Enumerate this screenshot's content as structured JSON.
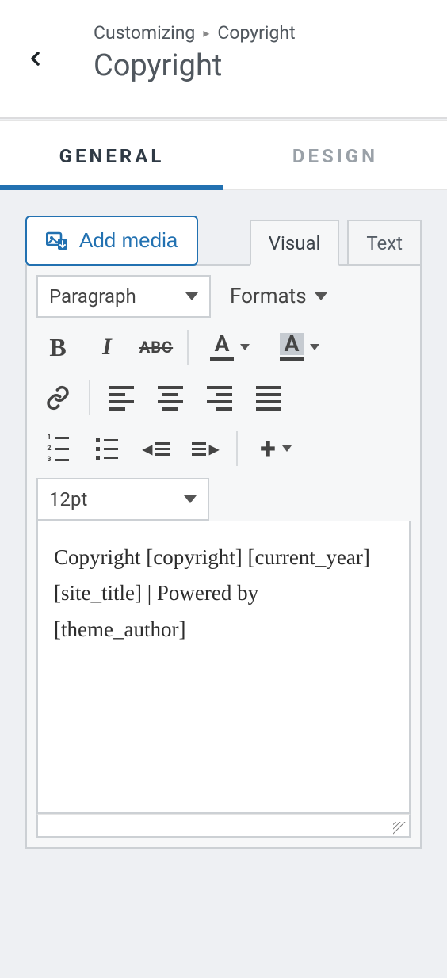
{
  "header": {
    "breadcrumb_root": "Customizing",
    "breadcrumb_current": "Copyright",
    "title": "Copyright"
  },
  "tabs": {
    "general": "GENERAL",
    "design": "DESIGN"
  },
  "editor": {
    "add_media_label": "Add media",
    "tab_visual": "Visual",
    "tab_text": "Text",
    "block_format": "Paragraph",
    "formats_label": "Formats",
    "font_size": "12pt",
    "strike_label": "ABC",
    "content": "Copyright [copyright] [current_year] [site_title] | Powered by [theme_author]"
  },
  "icons": {
    "text_color_glyph": "A",
    "bg_color_glyph": "A",
    "bold_glyph": "B",
    "italic_glyph": "I"
  },
  "colors": {
    "accent": "#2271b1"
  }
}
